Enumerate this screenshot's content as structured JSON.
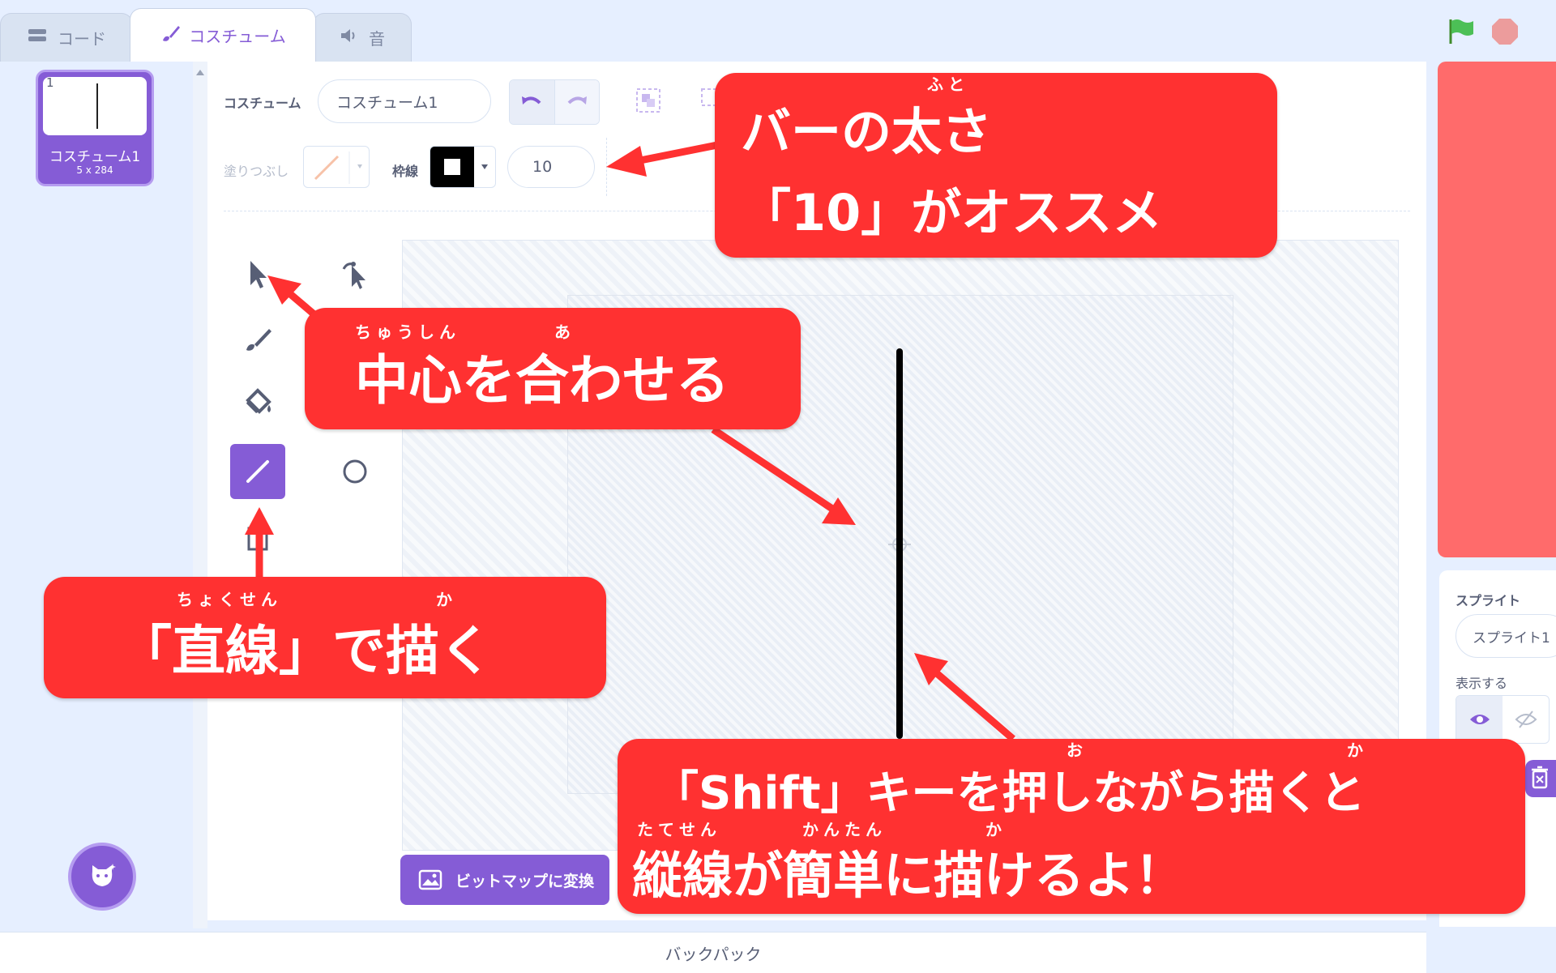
{
  "tabs": {
    "code": "コード",
    "costume": "コスチューム",
    "sound": "音"
  },
  "costume_list": {
    "items": [
      {
        "number": "1",
        "name": "コスチューム1",
        "size": "5 x 284"
      }
    ]
  },
  "editor": {
    "costume_label": "コスチューム",
    "costume_name": "コスチューム1",
    "fill_label": "塗りつぶし",
    "outline_label": "枠線",
    "outline_width": "10",
    "convert_button": "ビットマップに変換"
  },
  "sprite_panel": {
    "sprite_label": "スプライト",
    "sprite_name": "スプライト1",
    "show_label": "表示する"
  },
  "backpack": "バックパック",
  "callouts": {
    "thickness": {
      "line1": "バーの太さ",
      "line2": "「10」がオススメ",
      "ruby": "ふと"
    },
    "center": {
      "text": "中心を合わせる",
      "ruby1": "ちゅうしん",
      "ruby2": "あ"
    },
    "line_tool": {
      "text": "「直線」で描く",
      "ruby1": "ちょくせん",
      "ruby2": "か"
    },
    "shift": {
      "line1": "「Shift」キーを押しながら描くと",
      "line2": "縦線が簡単に描けるよ！",
      "ruby_o": "お",
      "ruby_ka1": "か",
      "ruby_tatesen": "たてせん",
      "ruby_kantan": "かんたん",
      "ruby_ka2": "か"
    }
  },
  "colors": {
    "accent": "#855cd6",
    "callout": "#ff3131",
    "stage": "#ff6b6b"
  }
}
